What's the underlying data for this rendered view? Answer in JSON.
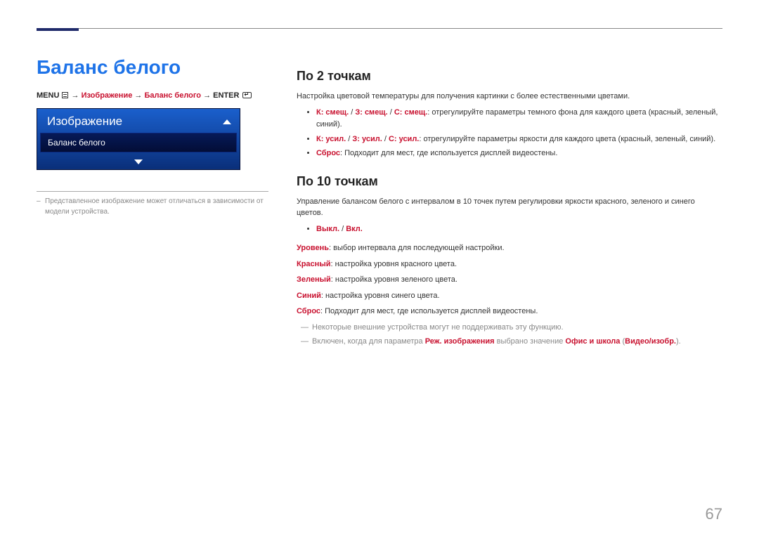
{
  "page_number": "67",
  "main_title": "Баланс белого",
  "breadcrumb": {
    "menu": "MENU",
    "arrow": "→",
    "path1": "Изображение",
    "path2": "Баланс белого",
    "enter": "ENTER"
  },
  "osd": {
    "title": "Изображение",
    "selected": "Баланс белого"
  },
  "left_footnote": "Представленное изображение может отличаться в зависимости от модели устройства.",
  "section1": {
    "heading": "По 2 точкам",
    "intro": "Настройка цветовой температуры для получения картинки с более естественными цветами.",
    "b1_term": "К: смещ.",
    "b1_sep": " / ",
    "b1_term2": "З: смещ.",
    "b1_term3": "С: смещ.",
    "b1_text": ": отрегулируйте параметры темного фона для каждого цвета (красный, зеленый, синий).",
    "b2_term": "К: усил.",
    "b2_term2": "З: усил.",
    "b2_term3": "С: усил.",
    "b2_text": ": отрегулируйте параметры яркости для каждого цвета (красный, зеленый, синий).",
    "b3_term": "Сброс",
    "b3_text": ": Подходит для мест, где используется дисплей видеостены."
  },
  "section2": {
    "heading": "По 10 точкам",
    "intro": "Управление балансом белого с интервалом в 10 точек путем регулировки яркости красного, зеленого и синего цветов.",
    "b1_term": "Выкл.",
    "b1_sep": " / ",
    "b1_term2": "Вкл.",
    "p_level_term": "Уровень",
    "p_level_text": ": выбор интервала для последующей настройки.",
    "p_red_term": "Красный",
    "p_red_text": ": настройка уровня красного цвета.",
    "p_green_term": "Зеленый",
    "p_green_text": ": настройка уровня зеленого цвета.",
    "p_blue_term": "Синий",
    "p_blue_text": ": настройка уровня синего цвета.",
    "p_reset_term": "Сброс",
    "p_reset_text": ": Подходит для мест, где используется дисплей видеостены.",
    "note1": "Некоторые внешние устройства могут не поддерживать эту функцию.",
    "note2_pre": "Включен, когда для параметра ",
    "note2_t1": "Реж. изображения",
    "note2_mid": " выбрано значение ",
    "note2_t2": "Офис и школа",
    "note2_open": " (",
    "note2_t3": "Видео/изобр.",
    "note2_close": ")."
  }
}
